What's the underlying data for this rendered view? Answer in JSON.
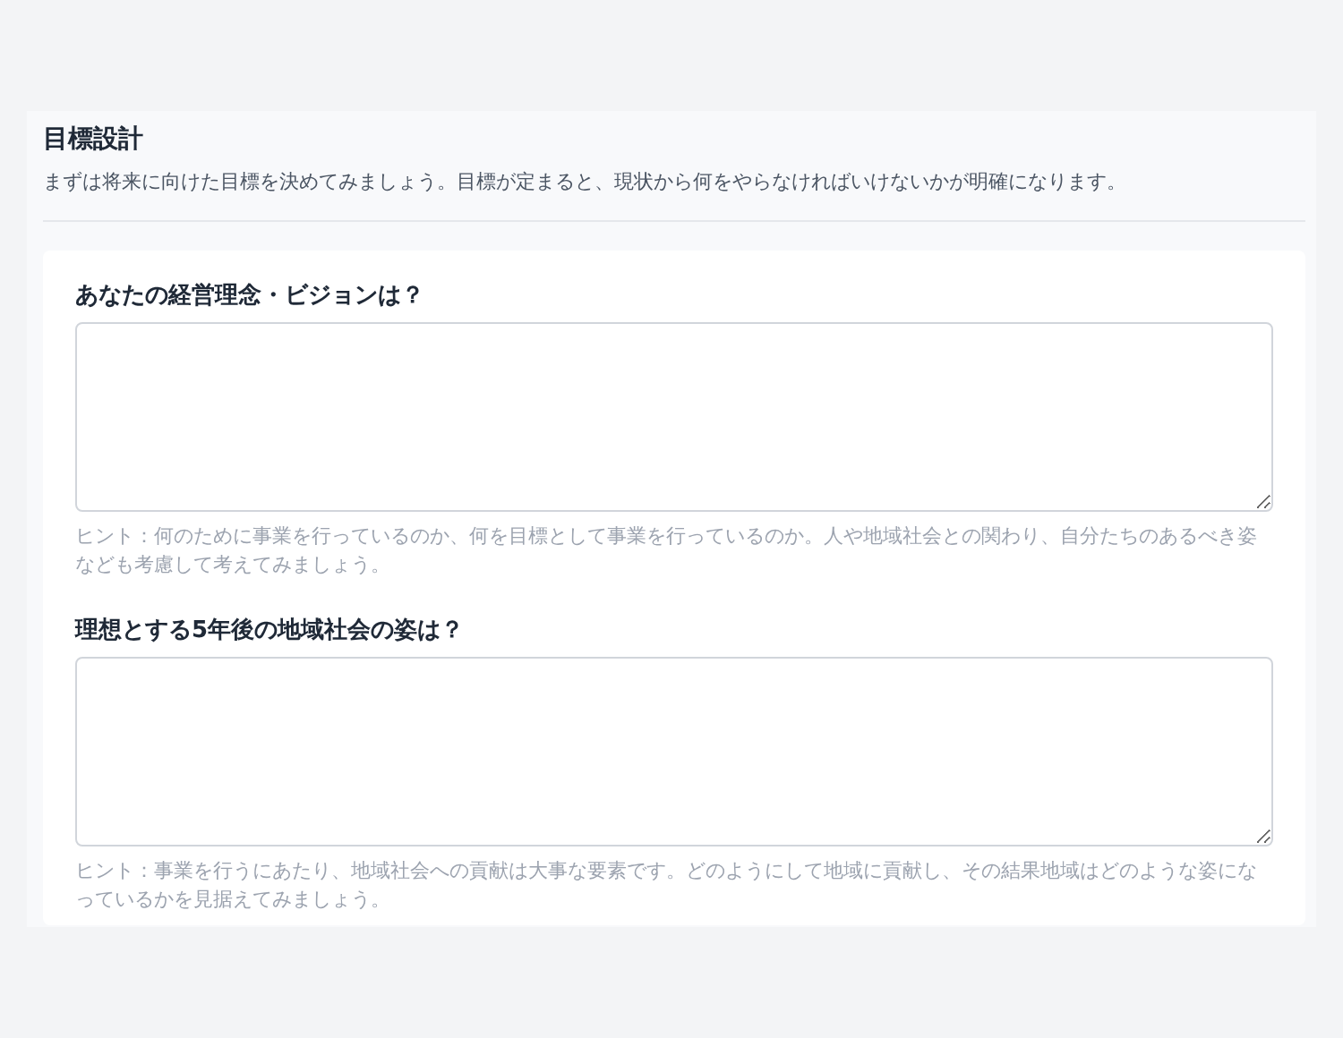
{
  "section": {
    "title": "目標設計",
    "description": "まずは将来に向けた目標を決めてみましょう。目標が定まると、現状から何をやらなければいけないかが明確になります。"
  },
  "questions": [
    {
      "label": "あなたの経営理念・ビジョンは？",
      "hint": "ヒント：何のために事業を行っているのか、何を目標として事業を行っているのか。人や地域社会との関わり、自分たちのあるべき姿なども考慮して考えてみましょう。"
    },
    {
      "label": "理想とする5年後の地域社会の姿は？",
      "hint": "ヒント：事業を行うにあたり、地域社会への貢献は大事な要素です。どのようにして地域に貢献し、その結果地域はどのような姿になっているかを見据えてみましょう。"
    }
  ]
}
